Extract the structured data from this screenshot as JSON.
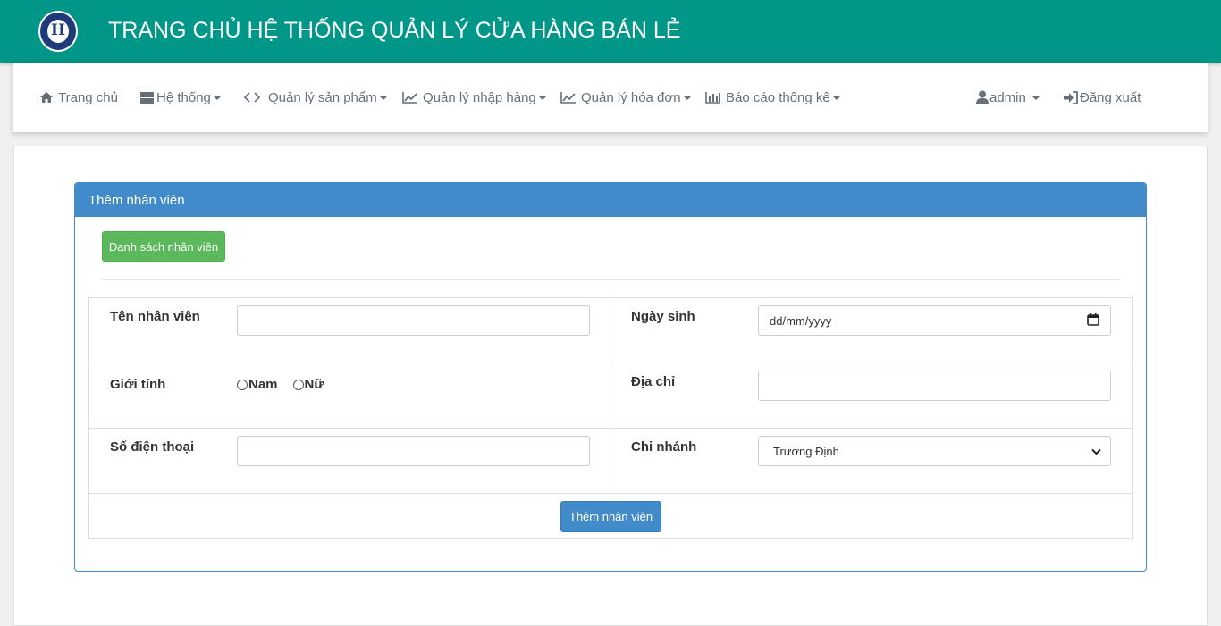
{
  "header": {
    "title": "TRANG CHỦ HỆ THỐNG QUẢN LÝ CỬA HÀNG BÁN LẺ",
    "logo_icon": "university-seal-icon",
    "bg_color": "#009688"
  },
  "nav": {
    "home": {
      "label": "Trang chủ",
      "icon": "home-icon"
    },
    "system": {
      "label": "Hệ thống",
      "icon": "grid-icon"
    },
    "products": {
      "label": "Quản lý sản phẩm",
      "icon": "code-icon"
    },
    "imports": {
      "label": "Quản lý nhập hàng",
      "icon": "line-chart-icon"
    },
    "invoices": {
      "label": "Quản lý hóa đơn",
      "icon": "line-chart-icon"
    },
    "reports": {
      "label": "Báo cáo thống kê",
      "icon": "bar-chart-icon"
    },
    "user": {
      "label": "admin",
      "icon": "user-icon"
    },
    "logout": {
      "label": "Đăng xuất",
      "icon": "sign-in-icon"
    }
  },
  "panel": {
    "title": "Thêm nhân viên",
    "list_button": "Danh sách nhân viên",
    "accent_color": "#428bca"
  },
  "form": {
    "name_label": "Tên nhân viên",
    "name_value": "",
    "dob_label": "Ngày sinh",
    "dob_placeholder": "dd/mm/yyyy",
    "gender_label": "Giới tính",
    "gender_options": [
      "Nam",
      "Nữ"
    ],
    "address_label": "Địa chỉ",
    "address_value": "",
    "phone_label": "Số điện thoại",
    "phone_value": "",
    "branch_label": "Chi nhánh",
    "branch_selected": "Trương Định",
    "submit_label": "Thêm nhân viên"
  }
}
